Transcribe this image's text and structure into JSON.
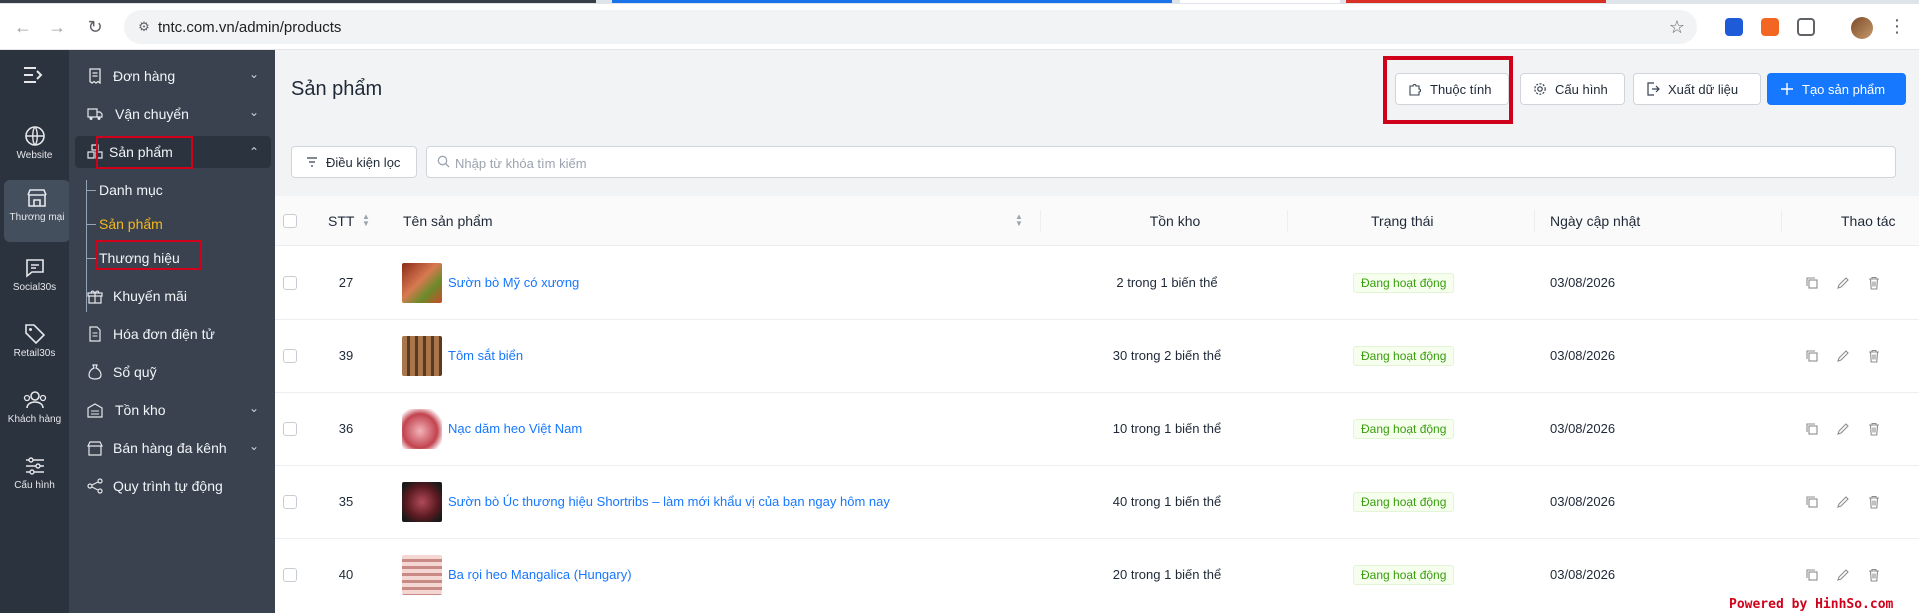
{
  "browser": {
    "url": "tntc.com.vn/admin/products"
  },
  "rail": {
    "items": [
      {
        "label": "Website"
      },
      {
        "label": "Thương mại"
      },
      {
        "label": "Social30s"
      },
      {
        "label": "Retail30s"
      },
      {
        "label": "Khách hàng"
      },
      {
        "label": "Cấu hình"
      }
    ]
  },
  "menu": {
    "items": [
      {
        "label": "Đơn hàng"
      },
      {
        "label": "Vận chuyển"
      },
      {
        "label": "Sản phẩm"
      },
      {
        "label": "Khuyến mãi"
      },
      {
        "label": "Hóa đơn điện tử"
      },
      {
        "label": "Sổ quỹ"
      },
      {
        "label": "Tồn kho"
      },
      {
        "label": "Bán hàng đa kênh"
      },
      {
        "label": "Quy trình tự động"
      }
    ],
    "subitems": [
      {
        "label": "Danh mục"
      },
      {
        "label": "Sản phẩm"
      },
      {
        "label": "Thương hiệu"
      }
    ]
  },
  "page": {
    "title": "Sản phẩm",
    "buttons": {
      "attributes": "Thuộc tính",
      "config": "Cấu hình",
      "export": "Xuất dữ liệu",
      "create": "Tạo sản phẩm"
    },
    "filter_label": "Điều kiện lọc",
    "search_placeholder": "Nhập từ khóa tìm kiếm"
  },
  "table": {
    "columns": {
      "stt": "STT",
      "name": "Tên sản phẩm",
      "stock": "Tồn kho",
      "status": "Trạng thái",
      "updated": "Ngày cập nhật",
      "actions": "Thao tác"
    },
    "rows": [
      {
        "stt": "27",
        "name": "Sườn bò Mỹ có xương",
        "stock": "2 trong 1 biến thể",
        "status": "Đang hoạt động",
        "updated": "03/08/2026"
      },
      {
        "stt": "39",
        "name": "Tôm sắt biển",
        "stock": "30 trong 2 biến thể",
        "status": "Đang hoạt động",
        "updated": "03/08/2026"
      },
      {
        "stt": "36",
        "name": "Nạc dăm heo Việt Nam",
        "stock": "10 trong 1 biến thể",
        "status": "Đang hoạt động",
        "updated": "03/08/2026"
      },
      {
        "stt": "35",
        "name": "Sườn bò Úc thương hiệu Shortribs – làm mới khẩu vị của bạn ngay hôm nay",
        "stock": "40 trong 1 biến thể",
        "status": "Đang hoạt động",
        "updated": "03/08/2026"
      },
      {
        "stt": "40",
        "name": "Ba rọi heo Mangalica (Hungary)",
        "stock": "20 trong 1 biến thể",
        "status": "Đang hoạt động",
        "updated": "03/08/2026"
      }
    ]
  },
  "watermark": "Powered by HinhSo.com",
  "colors": {
    "primary": "#1677ff",
    "rail_bg": "#2b333e",
    "menu_bg": "#39424e",
    "active_sub": "#f5b81c",
    "status_green": "#389e0d",
    "highlight_red": "#d0021b"
  }
}
